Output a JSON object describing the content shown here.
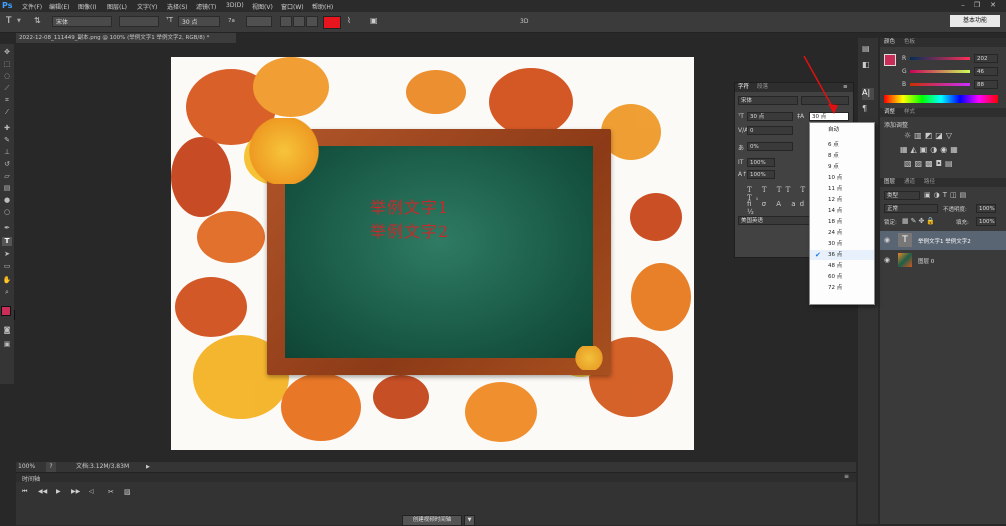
{
  "app": {
    "logo": "Ps"
  },
  "menus": [
    "文件(F)",
    "编辑(E)",
    "图像(I)",
    "图层(L)",
    "文字(Y)",
    "选择(S)",
    "滤镜(T)",
    "3D(D)",
    "视图(V)",
    "窗口(W)",
    "帮助(H)"
  ],
  "options": {
    "font_family": "宋体",
    "font_size": "30 点",
    "aa": "7a",
    "mode_3d": "3D",
    "workspace": "基本功能",
    "text_color": "#e8141e"
  },
  "document": {
    "tab_title": "2022-12-08_111449_副本.png @ 100% (举例文字1 举例文字2, RGB/8) *",
    "line1": "举例文字1",
    "line2": "举例文字2"
  },
  "status": {
    "zoom": "100%",
    "zoom_step": "?",
    "doc_info": "文档:3.12M/3.83M"
  },
  "timeline": {
    "title": "时间轴",
    "create_button": "创建视频时间轴"
  },
  "character_panel": {
    "tabs": [
      "字符",
      "段落"
    ],
    "font": "宋体",
    "size": "30 点",
    "leading": "30 点",
    "kerning": "0",
    "tracking": "0%",
    "vscale": "100%",
    "hscale": "100%",
    "language": "美国英语"
  },
  "size_dropdown": {
    "items": [
      "自动",
      "6 点",
      "8 点",
      "9 点",
      "10 点",
      "11 点",
      "12 点",
      "14 点",
      "18 点",
      "24 点",
      "30 点",
      "36 点",
      "48 点",
      "60 点",
      "72 点"
    ],
    "checked": "36 点"
  },
  "color_panel": {
    "tabs": [
      "颜色",
      "色板"
    ],
    "channels": [
      {
        "label": "R",
        "value": "202"
      },
      {
        "label": "G",
        "value": "46"
      },
      {
        "label": "B",
        "value": "88"
      }
    ],
    "swatch": "#ca2e58"
  },
  "adjust_panel": {
    "tabs": [
      "调整",
      "样式"
    ],
    "title": "添加调整"
  },
  "layers_panel": {
    "tabs": [
      "图层",
      "通道",
      "路径"
    ],
    "kind": "类型",
    "blend": "正常",
    "opacity_label": "不透明度:",
    "opacity": "100%",
    "lock_label": "锁定:",
    "fill_label": "填充:",
    "fill": "100%",
    "layers": [
      {
        "name": "举例文字1 举例文字2",
        "type": "text"
      },
      {
        "name": "图层 0",
        "type": "image"
      }
    ]
  }
}
